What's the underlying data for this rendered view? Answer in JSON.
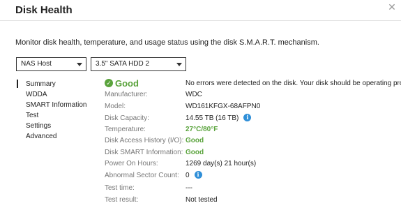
{
  "window": {
    "title": "Disk Health"
  },
  "description": "Monitor disk health, temperature, and usage status using the disk S.M.A.R.T. mechanism.",
  "selectors": {
    "host": "NAS Host",
    "disk": "3.5\" SATA HDD 2"
  },
  "nav": {
    "items": [
      "Summary",
      "WDDA",
      "SMART Information",
      "Test",
      "Settings",
      "Advanced"
    ]
  },
  "summary": {
    "status": "Good",
    "message": "No errors were detected on the disk. Your disk should be operating properly.",
    "rows": [
      {
        "label": "Manufacturer:",
        "value": "WDC"
      },
      {
        "label": "Model:",
        "value": "WD161KFGX-68AFPN0"
      },
      {
        "label": "Disk Capacity:",
        "value": "14.55 TB (16 TB)"
      },
      {
        "label": "Temperature:",
        "value": "27°C/80°F"
      },
      {
        "label": "Disk Access History (I/O):",
        "value": "Good"
      },
      {
        "label": "Disk SMART Information:",
        "value": "Good"
      },
      {
        "label": "Power On Hours:",
        "value": "1269 day(s) 21 hour(s)"
      },
      {
        "label": "Abnormal Sector Count:",
        "value": "0"
      },
      {
        "label": "Test time:",
        "value": "---"
      },
      {
        "label": "Test result:",
        "value": "Not tested"
      }
    ]
  },
  "colors": {
    "good": "#5aa33c",
    "info": "#2f8fd8"
  },
  "icons": {
    "status": "check-circle-icon",
    "info": "info-icon",
    "close": "close-icon",
    "dropdown": "chevron-down-icon"
  }
}
